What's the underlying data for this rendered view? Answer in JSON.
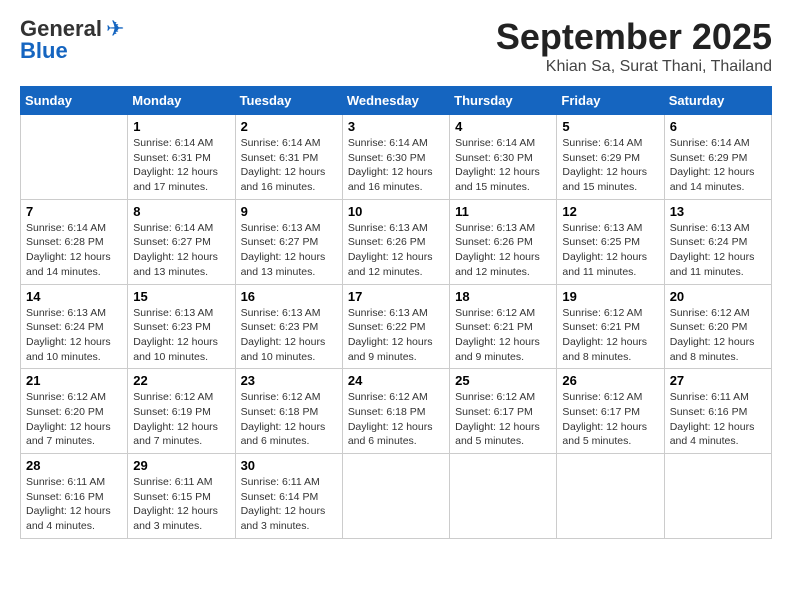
{
  "logo": {
    "line1": "General",
    "line2": "Blue"
  },
  "title": "September 2025",
  "subtitle": "Khian Sa, Surat Thani, Thailand",
  "days_of_week": [
    "Sunday",
    "Monday",
    "Tuesday",
    "Wednesday",
    "Thursday",
    "Friday",
    "Saturday"
  ],
  "weeks": [
    [
      {
        "day": "",
        "info": ""
      },
      {
        "day": "1",
        "info": "Sunrise: 6:14 AM\nSunset: 6:31 PM\nDaylight: 12 hours\nand 17 minutes."
      },
      {
        "day": "2",
        "info": "Sunrise: 6:14 AM\nSunset: 6:31 PM\nDaylight: 12 hours\nand 16 minutes."
      },
      {
        "day": "3",
        "info": "Sunrise: 6:14 AM\nSunset: 6:30 PM\nDaylight: 12 hours\nand 16 minutes."
      },
      {
        "day": "4",
        "info": "Sunrise: 6:14 AM\nSunset: 6:30 PM\nDaylight: 12 hours\nand 15 minutes."
      },
      {
        "day": "5",
        "info": "Sunrise: 6:14 AM\nSunset: 6:29 PM\nDaylight: 12 hours\nand 15 minutes."
      },
      {
        "day": "6",
        "info": "Sunrise: 6:14 AM\nSunset: 6:29 PM\nDaylight: 12 hours\nand 14 minutes."
      }
    ],
    [
      {
        "day": "7",
        "info": "Sunrise: 6:14 AM\nSunset: 6:28 PM\nDaylight: 12 hours\nand 14 minutes."
      },
      {
        "day": "8",
        "info": "Sunrise: 6:14 AM\nSunset: 6:27 PM\nDaylight: 12 hours\nand 13 minutes."
      },
      {
        "day": "9",
        "info": "Sunrise: 6:13 AM\nSunset: 6:27 PM\nDaylight: 12 hours\nand 13 minutes."
      },
      {
        "day": "10",
        "info": "Sunrise: 6:13 AM\nSunset: 6:26 PM\nDaylight: 12 hours\nand 12 minutes."
      },
      {
        "day": "11",
        "info": "Sunrise: 6:13 AM\nSunset: 6:26 PM\nDaylight: 12 hours\nand 12 minutes."
      },
      {
        "day": "12",
        "info": "Sunrise: 6:13 AM\nSunset: 6:25 PM\nDaylight: 12 hours\nand 11 minutes."
      },
      {
        "day": "13",
        "info": "Sunrise: 6:13 AM\nSunset: 6:24 PM\nDaylight: 12 hours\nand 11 minutes."
      }
    ],
    [
      {
        "day": "14",
        "info": "Sunrise: 6:13 AM\nSunset: 6:24 PM\nDaylight: 12 hours\nand 10 minutes."
      },
      {
        "day": "15",
        "info": "Sunrise: 6:13 AM\nSunset: 6:23 PM\nDaylight: 12 hours\nand 10 minutes."
      },
      {
        "day": "16",
        "info": "Sunrise: 6:13 AM\nSunset: 6:23 PM\nDaylight: 12 hours\nand 10 minutes."
      },
      {
        "day": "17",
        "info": "Sunrise: 6:13 AM\nSunset: 6:22 PM\nDaylight: 12 hours\nand 9 minutes."
      },
      {
        "day": "18",
        "info": "Sunrise: 6:12 AM\nSunset: 6:21 PM\nDaylight: 12 hours\nand 9 minutes."
      },
      {
        "day": "19",
        "info": "Sunrise: 6:12 AM\nSunset: 6:21 PM\nDaylight: 12 hours\nand 8 minutes."
      },
      {
        "day": "20",
        "info": "Sunrise: 6:12 AM\nSunset: 6:20 PM\nDaylight: 12 hours\nand 8 minutes."
      }
    ],
    [
      {
        "day": "21",
        "info": "Sunrise: 6:12 AM\nSunset: 6:20 PM\nDaylight: 12 hours\nand 7 minutes."
      },
      {
        "day": "22",
        "info": "Sunrise: 6:12 AM\nSunset: 6:19 PM\nDaylight: 12 hours\nand 7 minutes."
      },
      {
        "day": "23",
        "info": "Sunrise: 6:12 AM\nSunset: 6:18 PM\nDaylight: 12 hours\nand 6 minutes."
      },
      {
        "day": "24",
        "info": "Sunrise: 6:12 AM\nSunset: 6:18 PM\nDaylight: 12 hours\nand 6 minutes."
      },
      {
        "day": "25",
        "info": "Sunrise: 6:12 AM\nSunset: 6:17 PM\nDaylight: 12 hours\nand 5 minutes."
      },
      {
        "day": "26",
        "info": "Sunrise: 6:12 AM\nSunset: 6:17 PM\nDaylight: 12 hours\nand 5 minutes."
      },
      {
        "day": "27",
        "info": "Sunrise: 6:11 AM\nSunset: 6:16 PM\nDaylight: 12 hours\nand 4 minutes."
      }
    ],
    [
      {
        "day": "28",
        "info": "Sunrise: 6:11 AM\nSunset: 6:16 PM\nDaylight: 12 hours\nand 4 minutes."
      },
      {
        "day": "29",
        "info": "Sunrise: 6:11 AM\nSunset: 6:15 PM\nDaylight: 12 hours\nand 3 minutes."
      },
      {
        "day": "30",
        "info": "Sunrise: 6:11 AM\nSunset: 6:14 PM\nDaylight: 12 hours\nand 3 minutes."
      },
      {
        "day": "",
        "info": ""
      },
      {
        "day": "",
        "info": ""
      },
      {
        "day": "",
        "info": ""
      },
      {
        "day": "",
        "info": ""
      }
    ]
  ]
}
